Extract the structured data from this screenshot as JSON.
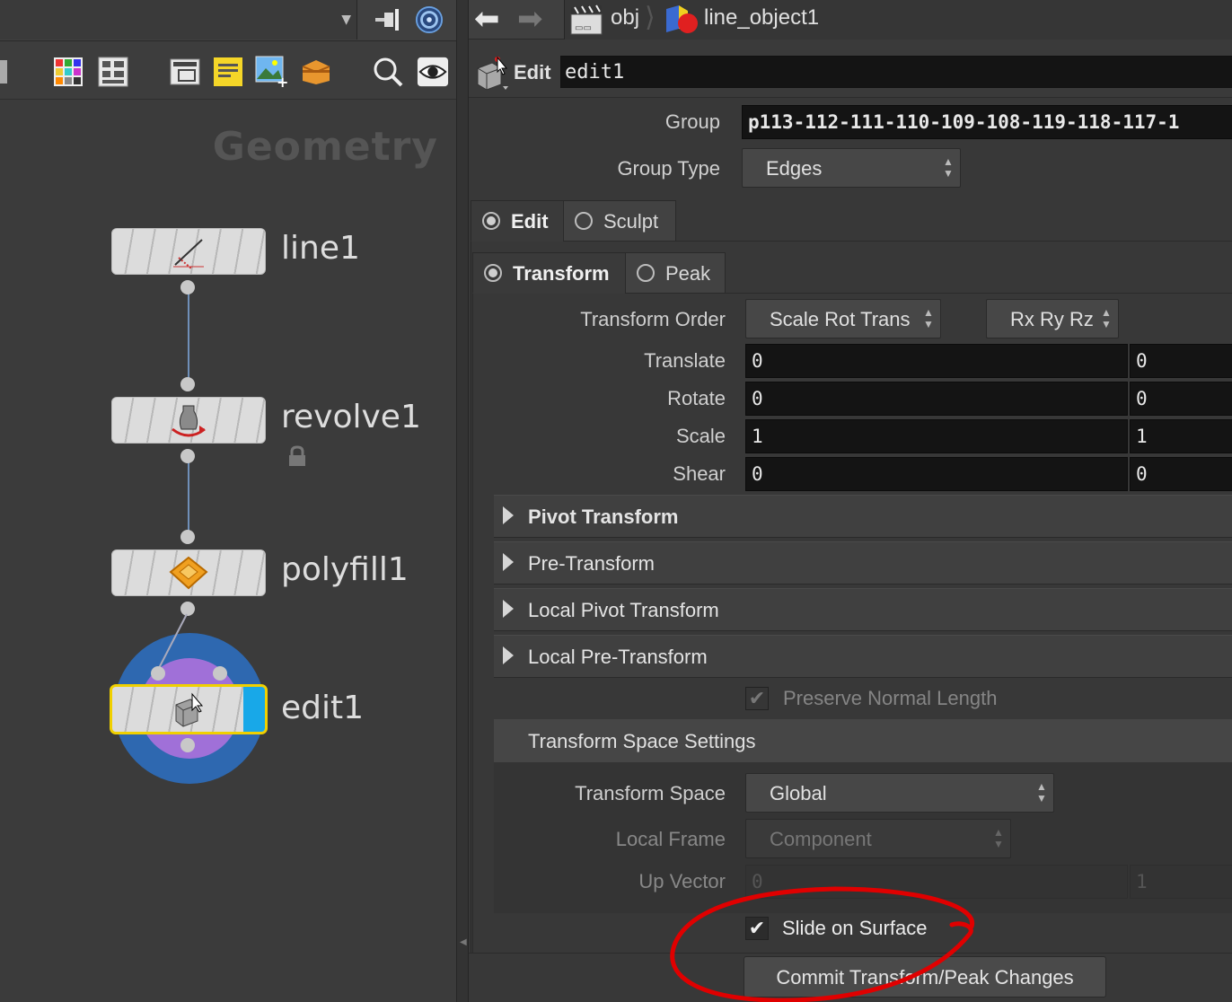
{
  "network": {
    "context_label": "Geometry",
    "nodes": [
      {
        "name": "line1",
        "type": "line"
      },
      {
        "name": "revolve1",
        "type": "revolve",
        "locked": true
      },
      {
        "name": "polyfill1",
        "type": "polyfill"
      },
      {
        "name": "edit1",
        "type": "edit",
        "selected": true,
        "display_flag": true
      }
    ],
    "colors": {
      "selection_outline": "#f0d000",
      "display_flag": "#18a8e8",
      "ring_outer": "#2e68b0",
      "ring_inner": "#a070d8"
    }
  },
  "path_bar": {
    "crumbs": [
      "obj",
      "line_object1"
    ]
  },
  "header": {
    "node_type_label": "Edit",
    "node_name": "edit1"
  },
  "params": {
    "group": {
      "label": "Group",
      "value": "p113-112-111-110-109-108-119-118-117-1"
    },
    "group_type": {
      "label": "Group Type",
      "value": "Edges"
    },
    "mode_tabs": [
      "Edit",
      "Sculpt"
    ],
    "mode_active": "Edit",
    "sub_tabs": [
      "Transform",
      "Peak"
    ],
    "sub_active": "Transform",
    "transform_order": {
      "label": "Transform Order",
      "value": "Scale Rot Trans",
      "rot_value": "Rx Ry Rz"
    },
    "translate": {
      "label": "Translate",
      "x": "0",
      "y": "0"
    },
    "rotate": {
      "label": "Rotate",
      "x": "0",
      "y": "0"
    },
    "scale": {
      "label": "Scale",
      "x": "1",
      "y": "1"
    },
    "shear": {
      "label": "Shear",
      "x": "0",
      "y": "0"
    },
    "folders": [
      "Pivot Transform",
      "Pre-Transform",
      "Local Pivot Transform",
      "Local Pre-Transform"
    ],
    "preserve_normal": {
      "label": "Preserve Normal Length",
      "checked": true,
      "enabled": false
    },
    "tss": {
      "header": "Transform Space Settings",
      "transform_space": {
        "label": "Transform Space",
        "value": "Global"
      },
      "local_frame": {
        "label": "Local Frame",
        "value": "Component"
      },
      "up_vector": {
        "label": "Up Vector",
        "x": "0",
        "y": "1"
      }
    },
    "slide_on_surface": {
      "label": "Slide on Surface",
      "checked": true
    },
    "commit_button": "Commit Transform/Peak Changes"
  },
  "annotation": {
    "color": "#e00000"
  }
}
